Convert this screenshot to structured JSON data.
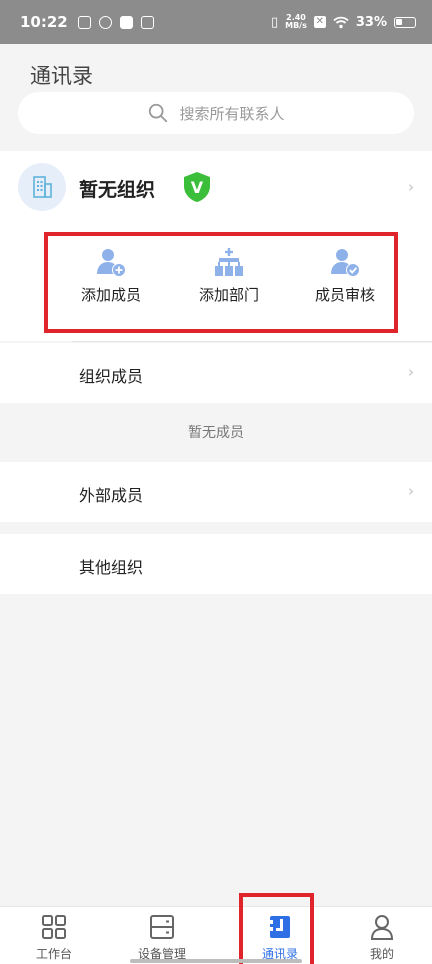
{
  "status": {
    "time": "10:22",
    "net_speed_top": "2.40",
    "net_speed_bottom": "MB/s",
    "battery": "33%"
  },
  "page": {
    "title": "通讯录"
  },
  "search": {
    "placeholder": "搜索所有联系人"
  },
  "org": {
    "name": "暂无组织",
    "badge": "V"
  },
  "actions": [
    {
      "label": "添加成员",
      "icon": "add-user-icon"
    },
    {
      "label": "添加部门",
      "icon": "add-department-icon"
    },
    {
      "label": "成员审核",
      "icon": "member-review-icon"
    }
  ],
  "lists": {
    "org_members": "组织成员",
    "empty_members": "暂无成员",
    "external_members": "外部成员",
    "other_orgs": "其他组织"
  },
  "tabs": [
    {
      "label": "工作台",
      "icon": "grid-icon"
    },
    {
      "label": "设备管理",
      "icon": "device-icon"
    },
    {
      "label": "通讯录",
      "icon": "contacts-icon",
      "active": true
    },
    {
      "label": "我的",
      "icon": "person-icon"
    }
  ],
  "colors": {
    "accent": "#2f6fe6",
    "highlight": "#e0242b",
    "icon_blue": "#8fb1ea",
    "badge_green": "#3bbf3b"
  }
}
